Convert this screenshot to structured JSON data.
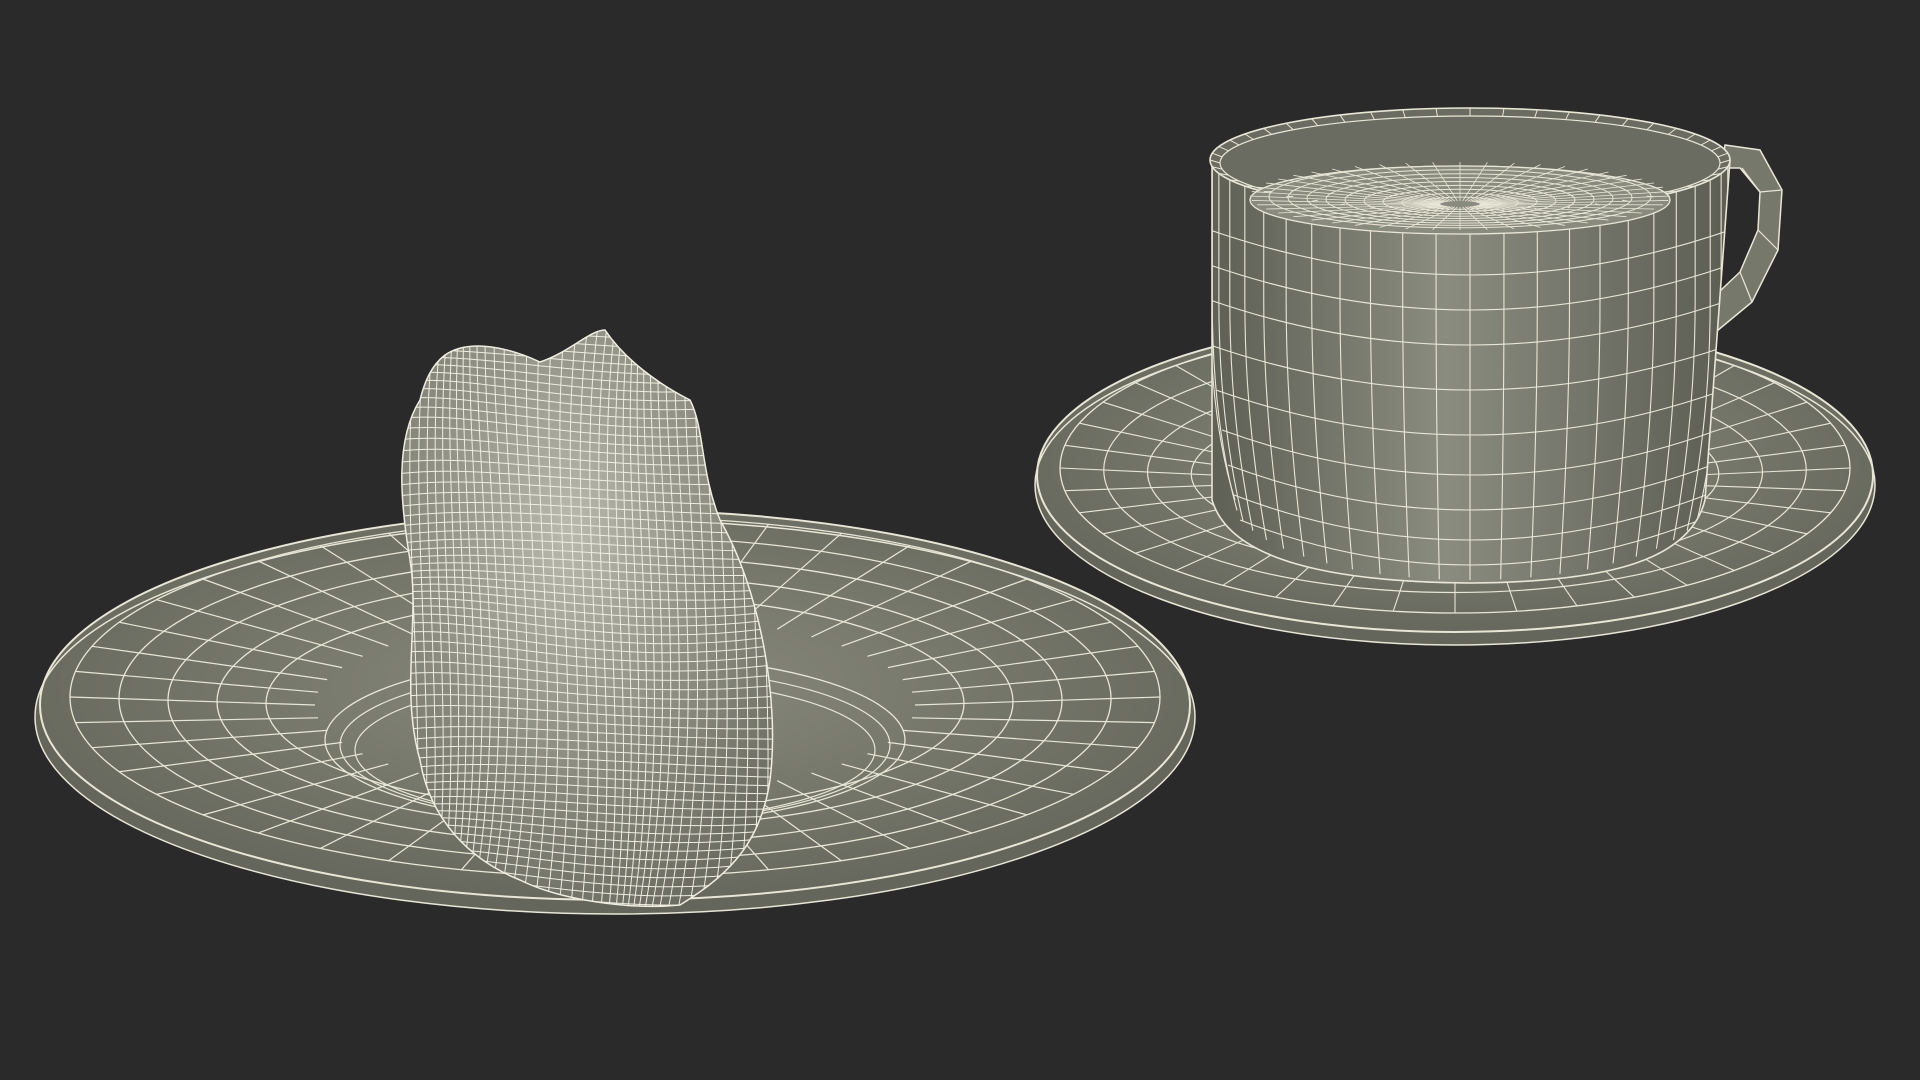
{
  "scene": {
    "background_color": "#2a2a2a",
    "mesh_fill_color": "#76776b",
    "wire_color": "#e8e6d6",
    "objects": [
      {
        "name": "plate",
        "kind": "wireframe 3D model"
      },
      {
        "name": "croissant",
        "kind": "wireframe 3D model"
      },
      {
        "name": "saucer",
        "kind": "wireframe 3D model"
      },
      {
        "name": "cup",
        "kind": "wireframe 3D model"
      }
    ]
  }
}
